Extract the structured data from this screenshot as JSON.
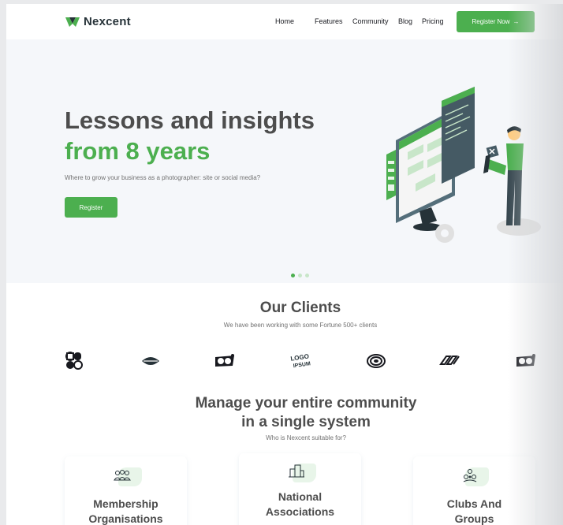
{
  "brand": {
    "name": "Nexcent"
  },
  "nav": {
    "links": [
      "Home",
      "Features",
      "Community",
      "Blog",
      "Pricing"
    ],
    "cta": "Register Now",
    "cta_arrow": "→"
  },
  "hero": {
    "title_line1": "Lessons and insights",
    "title_line2": "from 8 years",
    "subtitle": "Where to grow your business as a photographer: site or social media?",
    "button": "Register",
    "slides": {
      "count": 3,
      "active": 1
    }
  },
  "clients": {
    "title": "Our Clients",
    "subtitle": "We have been working with some Fortune 500+ clients",
    "logos": [
      "grid-logo-icon",
      "lips-logo-icon",
      "oo-logo-icon",
      "logoipsum-logo-icon",
      "rings-logo-icon",
      "links-logo-icon",
      "oo-logo-icon"
    ]
  },
  "community": {
    "title_line1": "Manage your entire community",
    "title_line2": "in a single system",
    "subtitle": "Who is Nexcent suitable for?",
    "cards": [
      {
        "line1": "Membership",
        "line2": "Organisations",
        "icon": "people-icon"
      },
      {
        "line1": "National",
        "line2": "Associations",
        "icon": "buildings-icon"
      },
      {
        "line1": "Clubs And",
        "line2": "Groups",
        "icon": "group-icon"
      }
    ]
  },
  "colors": {
    "primary": "#4caf4f",
    "dark": "#263238",
    "text": "#4d4d4d",
    "muted": "#717171",
    "hero_bg": "#f5f7fa"
  }
}
